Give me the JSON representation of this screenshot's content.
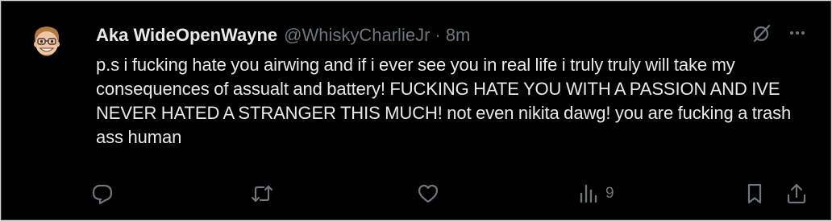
{
  "tweet": {
    "display_name": "Aka WideOpenWayne",
    "handle": "@WhiskyCharlieJr",
    "separator": "·",
    "time": "8m",
    "text": "p.s i fucking hate you airwing and if i ever see you in real life i truly truly will take my consequences of assualt and battery! FUCKING HATE YOU WITH A PASSION AND IVE NEVER HATED A STRANGER THIS MUCH! not even nikita dawg! you are fucking a trash ass human"
  },
  "header_icons": [
    "grok-icon",
    "more-icon"
  ],
  "actions": {
    "reply": {
      "icon": "reply-icon",
      "count": ""
    },
    "retweet": {
      "icon": "retweet-icon",
      "count": ""
    },
    "like": {
      "icon": "heart-icon",
      "count": ""
    },
    "views": {
      "icon": "views-icon",
      "count": "9"
    },
    "bookmark": {
      "icon": "bookmark-icon",
      "count": ""
    },
    "share": {
      "icon": "share-icon",
      "count": ""
    }
  },
  "colors": {
    "background": "#000000",
    "text_primary": "#e7e9ea",
    "text_secondary": "#71767b",
    "border": "#2f3336"
  }
}
